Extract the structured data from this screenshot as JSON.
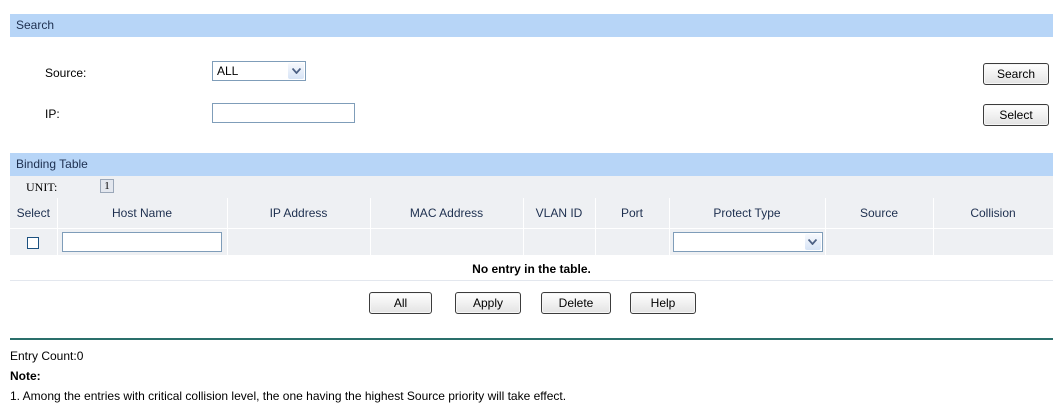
{
  "search": {
    "title": "Search",
    "source_label": "Source:",
    "source_value": "ALL",
    "ip_label": "IP:",
    "ip_value": "",
    "search_button": "Search",
    "select_button": "Select"
  },
  "binding": {
    "title": "Binding Table",
    "unit_label": "UNIT:",
    "unit_value": "1",
    "columns": [
      "Select",
      "Host Name",
      "IP Address",
      "MAC Address",
      "VLAN ID",
      "Port",
      "Protect Type",
      "Source",
      "Collision"
    ],
    "host_name_value": "",
    "protect_type_value": "",
    "empty_message": "No entry in the table."
  },
  "actions": {
    "all": "All",
    "apply": "Apply",
    "delete": "Delete",
    "help": "Help"
  },
  "footer": {
    "entry_count": "Entry Count:0",
    "note_title": "Note:",
    "note_1": "1. Among the entries with critical collision level, the one having the highest Source priority will take effect."
  },
  "colors": {
    "header_bar": "#b7d5f7",
    "row_bg": "#eef0f3",
    "separator": "#2a6f6b"
  }
}
